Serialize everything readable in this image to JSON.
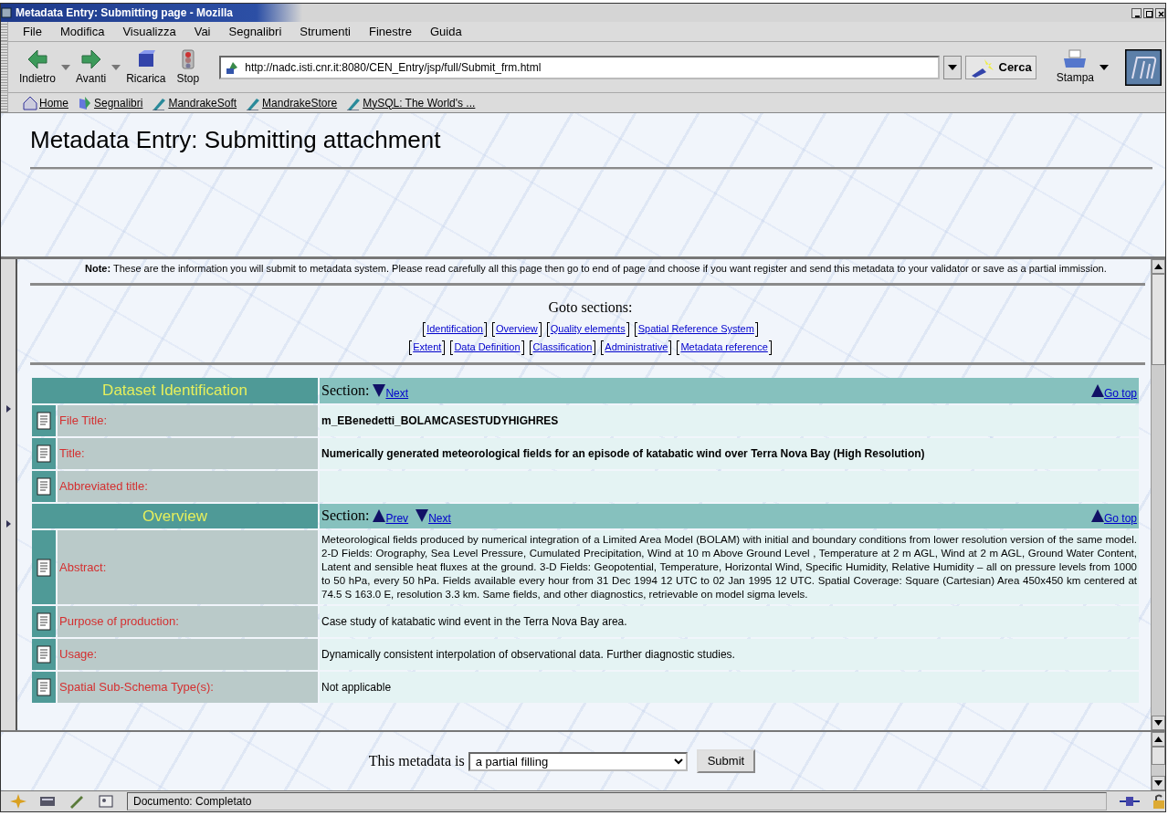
{
  "window": {
    "title": "Metadata Entry: Submitting page - Mozilla"
  },
  "menu": [
    "File",
    "Modifica",
    "Visualizza",
    "Vai",
    "Segnalibri",
    "Strumenti",
    "Finestre",
    "Guida"
  ],
  "toolbar": {
    "nav_buttons": [
      {
        "label": "Indietro",
        "kind": "back",
        "dropdown": true
      },
      {
        "label": "Avanti",
        "kind": "forward",
        "dropdown": true
      },
      {
        "label": "Ricarica",
        "kind": "reload",
        "dropdown": false
      },
      {
        "label": "Stop",
        "kind": "stop",
        "dropdown": false
      }
    ],
    "url": "http://nadc.isti.cnr.it:8080/CEN_Entry/jsp/full/Submit_frm.html",
    "search_button": "Cerca",
    "print_button": "Stampa"
  },
  "bookmarks": [
    {
      "label": "Home",
      "kind": "home"
    },
    {
      "label": "Segnalibri",
      "kind": "folder"
    },
    {
      "label": "MandrakeSoft",
      "kind": "link"
    },
    {
      "label": "MandrakeStore",
      "kind": "link"
    },
    {
      "label": "MySQL: The World's ...",
      "kind": "link"
    }
  ],
  "page": {
    "heading": "Metadata Entry: Submitting attachment",
    "note": "**Note:** These are the information you will submit to metadata system. Please read carefully all this page then go to end of page and choose if you want register and send this metadata to your validator or save as a partial immission.",
    "goto_title": "Goto sections:",
    "goto_rows": [
      [
        "Identification",
        "Overview",
        "Quality elements",
        "Spatial Reference System"
      ],
      [
        "Extent",
        "Data Definition",
        "Classification",
        "Administrative",
        "Metadata reference"
      ]
    ],
    "sections": [
      {
        "title": "Dataset Identification",
        "section_label": "Section:",
        "nav": [
          {
            "label": "Next",
            "kind": "down"
          }
        ],
        "top_link": "Go top",
        "fields": [
          {
            "label": "File Title:",
            "value": "m_EBenedetti_BOLAMCASESTUDYHIGHRES",
            "bold": true
          },
          {
            "label": "Title:",
            "value": "Numerically generated meteorological fields for an episode of katabatic wind over Terra Nova Bay (High Resolution)",
            "bold": true
          },
          {
            "label": "Abbreviated title:"
          }
        ]
      },
      {
        "title": "Overview",
        "section_label": "Section:",
        "nav": [
          {
            "label": "Prev",
            "kind": "up"
          },
          {
            "label": "Next",
            "kind": "down"
          }
        ],
        "top_link": "Go top",
        "fields": [
          {
            "label": "Abstract:",
            "value": "Meteorological fields produced by numerical integration of a Limited Area Model (BOLAM) with initial and boundary conditions from lower resolution version of the same model. 2-D Fields: Orography, Sea Level Pressure, Cumulated Precipitation, Wind at 10 m Above Ground Level , Temperature at 2 m AGL, Wind at 2 m AGL, Ground Water Content, Latent and sensible heat fluxes at the ground. 3-D Fields: Geopotential, Temperature, Horizontal Wind, Specific Humidity, Relative Humidity – all on pressure levels from 1000 to 50 hPa, every 50 hPa. Fields available every hour from 31 Dec 1994 12 UTC to 02 Jan 1995 12 UTC. Spatial Coverage: Square (Cartesian) Area 450x450 km centered at 74.5 S 163.0 E, resolution 3.3 km. Same fields, and other diagnostics, retrievable on model sigma levels.",
            "bold": false
          },
          {
            "label": "Purpose of production:",
            "value": "Case study of katabatic wind event in the Terra Nova Bay area.",
            "bold": false
          },
          {
            "label": "Usage:",
            "value": "Dynamically consistent interpolation of observational data. Further diagnostic studies.",
            "bold": false
          },
          {
            "label": "Spatial Sub-Schema Type(s):",
            "value": "Not applicable",
            "bold": false
          }
        ]
      }
    ]
  },
  "form": {
    "label": "This metadata is",
    "select_value": "a partial filling",
    "submit": "Submit"
  },
  "status_bar": {
    "text": "Documento: Completato"
  }
}
